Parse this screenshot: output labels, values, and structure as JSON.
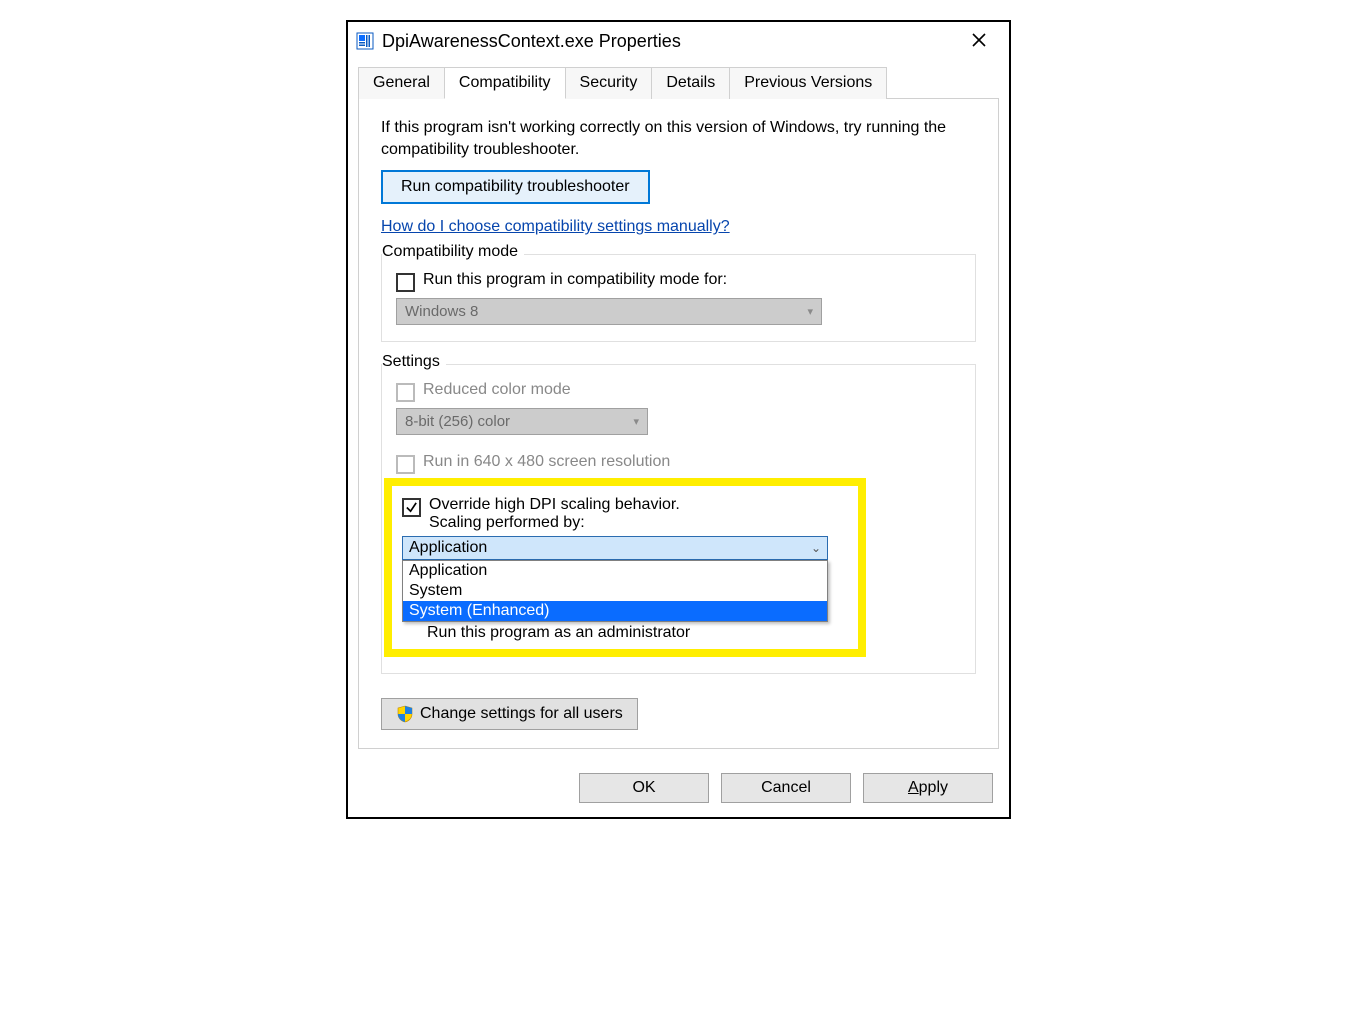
{
  "window": {
    "title": "DpiAwarenessContext.exe Properties"
  },
  "tabs": {
    "general": "General",
    "compatibility": "Compatibility",
    "security": "Security",
    "details": "Details",
    "previous": "Previous Versions",
    "active": "compatibility"
  },
  "intro": "If this program isn't working correctly on this version of Windows, try running the compatibility troubleshooter.",
  "troubleshooter_btn": "Run compatibility troubleshooter",
  "manual_link": "How do I choose compatibility settings manually? ",
  "compat_group": {
    "label": "Compatibility mode",
    "checkbox": "Run this program in compatibility mode for:",
    "select_value": "Windows 8"
  },
  "settings_group": {
    "label": "Settings",
    "reduced_color": "Reduced color mode",
    "color_select": "8-bit (256) color",
    "run_640": "Run in 640 x 480 screen resolution",
    "override_dpi_l1": "Override high DPI scaling behavior.",
    "override_dpi_l2": "Scaling performed by:",
    "dpi_select_value": "Application",
    "dpi_options": [
      "Application",
      "System",
      "System (Enhanced)"
    ],
    "dpi_selected_index": 2,
    "run_admin": "Run this program as an administrator"
  },
  "change_all_btn": "Change settings for all users",
  "footer": {
    "ok": "OK",
    "cancel": "Cancel",
    "apply": "Apply"
  }
}
